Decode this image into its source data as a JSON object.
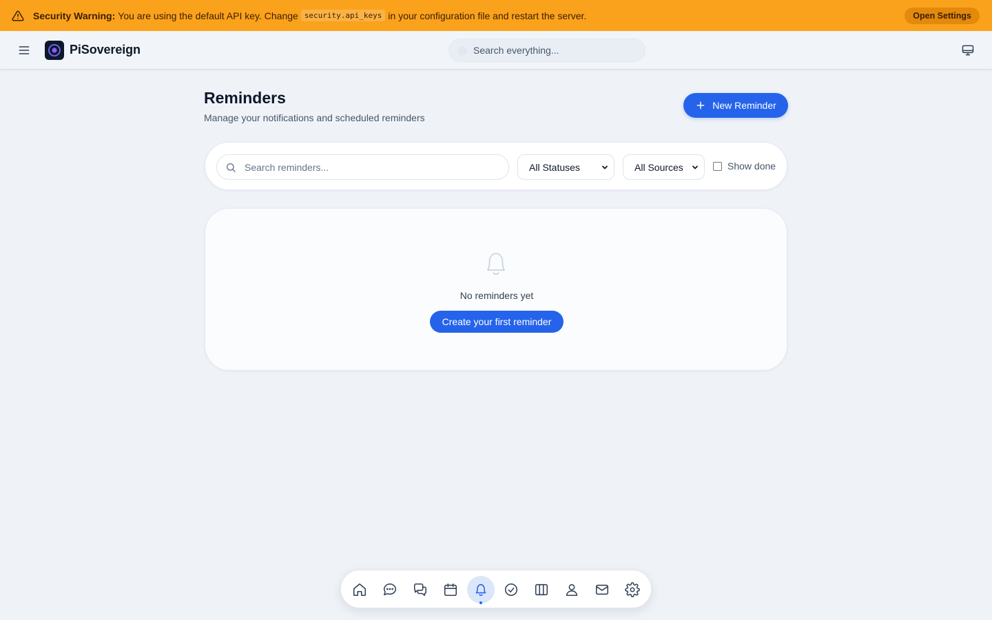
{
  "banner": {
    "title": "Security Warning:",
    "text_before": "You are using the default API key. Change",
    "code": "security.api_keys",
    "text_after": "in your configuration file and restart the server.",
    "button_label": "Open Settings"
  },
  "header": {
    "brand": "PiSovereign",
    "search_placeholder": "Search everything..."
  },
  "page": {
    "title": "Reminders",
    "subtitle": "Manage your notifications and scheduled reminders",
    "new_button_label": "New Reminder"
  },
  "filters": {
    "search_placeholder": "Search reminders...",
    "status_selected": "All Statuses",
    "source_selected": "All Sources",
    "show_done_label": "Show done",
    "show_done_checked": false
  },
  "empty": {
    "message": "No reminders yet",
    "button_label": "Create your first reminder"
  },
  "dock": {
    "items": [
      {
        "icon": "home-icon"
      },
      {
        "icon": "chat-icon"
      },
      {
        "icon": "conversations-icon"
      },
      {
        "icon": "calendar-icon"
      },
      {
        "icon": "bell-icon",
        "active": true
      },
      {
        "icon": "check-circle-icon"
      },
      {
        "icon": "columns-icon"
      },
      {
        "icon": "user-icon"
      },
      {
        "icon": "mail-icon"
      },
      {
        "icon": "gear-icon"
      }
    ]
  },
  "colors": {
    "banner_bg": "#fba21c",
    "primary": "#2563eb",
    "page_bg": "#eff3f8"
  }
}
